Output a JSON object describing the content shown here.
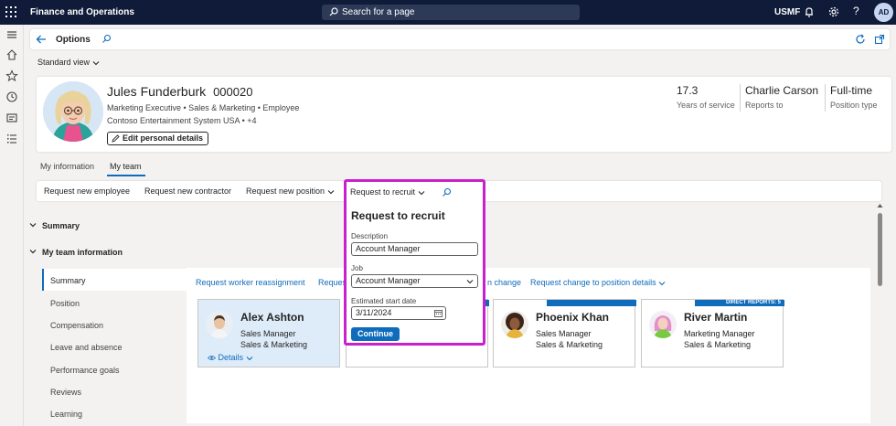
{
  "topbar": {
    "app_title": "Finance and Operations",
    "search_placeholder": "Search for a page",
    "company": "USMF",
    "user_initials": "AD"
  },
  "actionbar": {
    "page_title": "Options"
  },
  "view": {
    "label": "Standard view"
  },
  "employee": {
    "name": "Jules Funderburk",
    "id": "000020",
    "line1": "Marketing Executive  •  Sales & Marketing  •  Employee",
    "line2": "Contoso Entertainment System USA  •  +4",
    "edit_label": "Edit personal details",
    "stats": [
      {
        "value": "17.3",
        "label": "Years of service"
      },
      {
        "value": "Charlie Carson",
        "label": "Reports to"
      },
      {
        "value": "Full-time",
        "label": "Position type"
      }
    ]
  },
  "tabs": [
    {
      "label": "My information"
    },
    {
      "label": "My team"
    }
  ],
  "toolbar": {
    "items": [
      "Request new employee",
      "Request new contractor",
      "Request new position",
      "Request to recruit"
    ]
  },
  "sections": {
    "summary": "Summary",
    "team_info": "My team information"
  },
  "subnav": [
    "Summary",
    "Position",
    "Compensation",
    "Leave and absence",
    "Performance goals",
    "Reviews",
    "Learning"
  ],
  "panel_links": [
    "Request worker reassignment",
    "Reques",
    "n change",
    "Request change to position details"
  ],
  "people": [
    {
      "name": "Alex Ashton",
      "title": "Sales Manager",
      "dept": "Sales & Marketing",
      "badge": "",
      "details": "Details"
    },
    {
      "name": "",
      "title": "",
      "dept": "",
      "badge": ""
    },
    {
      "name": "Phoenix Khan",
      "title": "Sales Manager",
      "dept": "Sales & Marketing",
      "badge": ""
    },
    {
      "name": "River Martin",
      "title": "Marketing Manager",
      "dept": "Sales & Marketing",
      "badge": "DIRECT REPORTS: 5"
    }
  ],
  "popup": {
    "header_label": "Request to recruit",
    "title": "Request to recruit",
    "description_label": "Description",
    "description_value": "Account Manager",
    "job_label": "Job",
    "job_value": "Account Manager",
    "start_label": "Estimated start date",
    "start_value": "3/11/2024",
    "continue_label": "Continue"
  },
  "colors": {
    "topbar": "#0f1b38",
    "accent": "#0f6cbd",
    "highlight": "#c81fcf"
  }
}
